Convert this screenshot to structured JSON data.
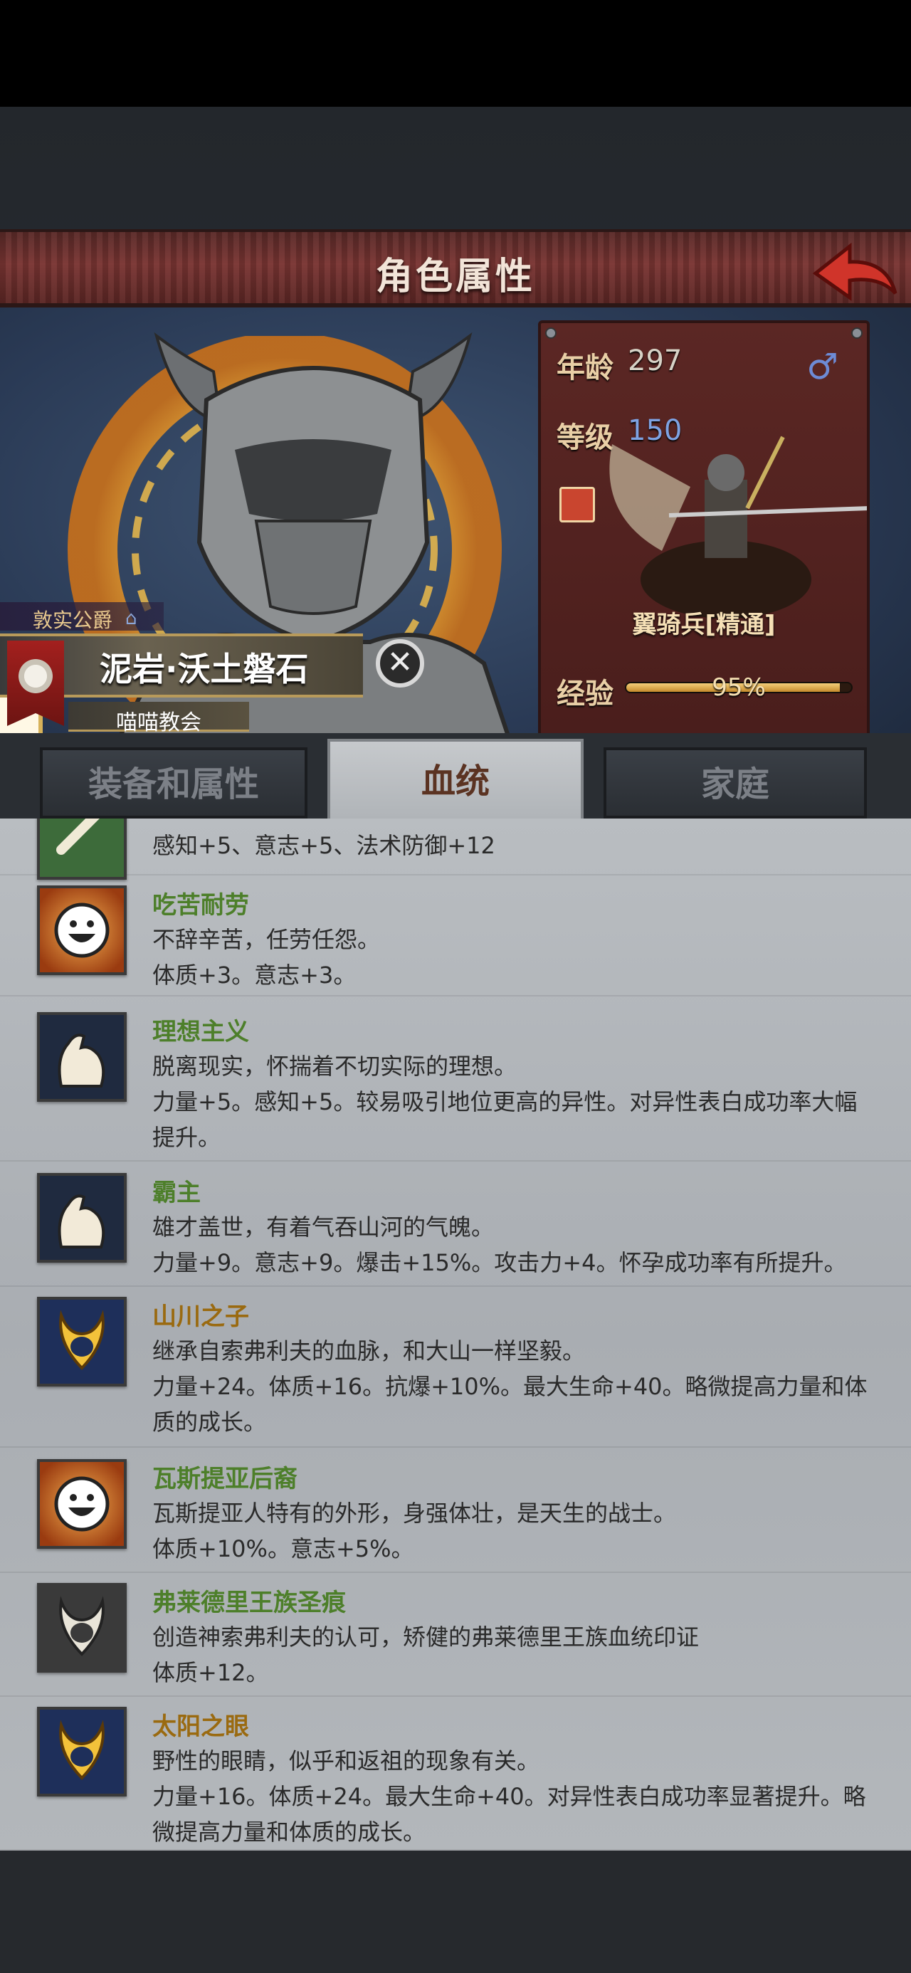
{
  "header": {
    "title": "角色属性"
  },
  "character": {
    "title_tag": "敦实公爵",
    "name": "泥岩·沃土磐石",
    "guild": "喵喵教会"
  },
  "info": {
    "age_label": "年龄",
    "age_value": "297",
    "gender": "♂",
    "level_label": "等级",
    "level_value": "150",
    "unit_name": "翼骑兵[精通]",
    "exp_label": "经验",
    "exp_value": "95%",
    "exp_fraction": 0.95
  },
  "tabs": [
    {
      "label": "装备和属性",
      "active": false
    },
    {
      "label": "血统",
      "active": true
    },
    {
      "label": "家庭",
      "active": false
    }
  ],
  "traits": [
    {
      "name": "",
      "lines": [
        "感知+5、意志+5、法术防御+12"
      ],
      "icon": "bone-icon",
      "color": "green"
    },
    {
      "name": "吃苦耐劳",
      "lines": [
        "不辞辛苦，任劳任怨。",
        "体质+3。意志+3。"
      ],
      "icon": "smile-face-icon",
      "color": "green"
    },
    {
      "name": "理想主义",
      "lines": [
        "脱离现实，怀揣着不切实际的理想。",
        "力量+5。感知+5。较易吸引地位更高的异性。对异性表白成功率大幅",
        "提升。"
      ],
      "icon": "flexed-arm-icon",
      "color": "green"
    },
    {
      "name": "霸主",
      "lines": [
        "雄才盖世，有着气吞山河的气魄。",
        "力量+9。意志+9。爆击+15%。攻击力+4。怀孕成功率有所提升。"
      ],
      "icon": "flexed-arm-icon",
      "color": "green"
    },
    {
      "name": "山川之子",
      "lines": [
        "继承自索弗利夫的血脉，和大山一样坚毅。",
        "力量+24。体质+16。抗爆+10%。最大生命+40。略微提高力量和体",
        "质的成长。"
      ],
      "icon": "golden-emblem-icon",
      "color": "gold"
    },
    {
      "name": "瓦斯提亚后裔",
      "lines": [
        "瓦斯提亚人特有的外形，身强体壮，是天生的战士。",
        "体质+10%。意志+5%。"
      ],
      "icon": "smile-face-icon",
      "color": "green"
    },
    {
      "name": "弗莱德里王族圣痕",
      "lines": [
        "创造神索弗利夫的认可，矫健的弗莱德里王族血统印证",
        "体质+12。"
      ],
      "icon": "silver-emblem-icon",
      "color": "green"
    },
    {
      "name": "太阳之眼",
      "lines": [
        "野性的眼睛，似乎和返祖的现象有关。",
        "力量+16。体质+24。最大生命+40。对异性表白成功率显著提升。略",
        "微提高力量和体质的成长。"
      ],
      "icon": "golden-emblem-icon",
      "color": "gold"
    }
  ]
}
